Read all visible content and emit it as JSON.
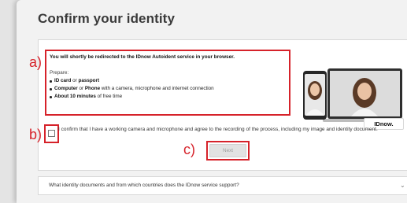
{
  "page": {
    "title": "Confirm your identity"
  },
  "annotations": {
    "a": "a)",
    "b": "b)",
    "c": "c)"
  },
  "info": {
    "heading": "You will shortly be redirected to the IDnow Autoident service in your browser.",
    "prepare_label": "Prepare:",
    "items": [
      {
        "bold": "ID card",
        "mid": " or ",
        "bold2": "passport",
        "rest": ""
      },
      {
        "bold": "Computer",
        "mid": " or ",
        "bold2": "Phone",
        "rest": " with a camera, microphone and internet connection"
      },
      {
        "bold": "About 10 minutes",
        "mid": " of free time",
        "bold2": "",
        "rest": ""
      }
    ]
  },
  "consent": {
    "text": "I confirm that I have a working camera and microphone and agree to the recording of the process, including my image and identity document.",
    "checked": false
  },
  "next_button": {
    "label": "Next",
    "enabled": false
  },
  "faq": {
    "question": "What identity documents and from which countries does the IDnow service support?"
  },
  "brand": {
    "badge": "IDnow.",
    "accent": "#d6222a"
  },
  "icons": {
    "faq_toggle": "chevron-down-icon"
  }
}
